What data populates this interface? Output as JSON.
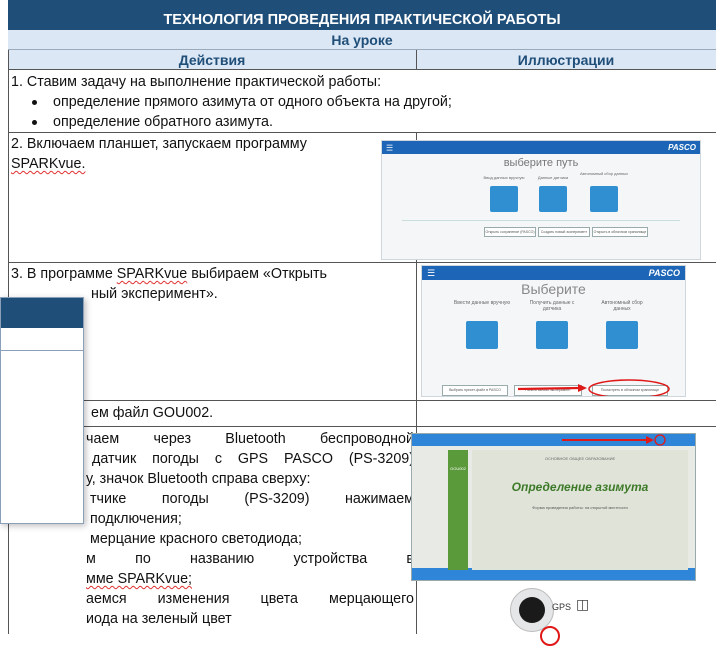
{
  "table": {
    "title": "ТЕХНОЛОГИЯ ПРОВЕДЕНИЯ ПРАКТИЧЕСКОЙ РАБОТЫ",
    "subtitle": "На уроке",
    "col_actions": "Действия",
    "col_illustrations": "Иллюстрации",
    "step1": {
      "text": "1. Ставим задачу на выполнение практической работы:",
      "bullets": [
        "определение прямого азимута от одного объекта на другой;",
        "определение обратного азимута."
      ]
    },
    "step2": {
      "line1": "2. Включаем планшет, запускаем программу",
      "line2": "SPARKvue."
    },
    "step3": {
      "line1_a": "3. В программе ",
      "line1_word": "SPARKvue",
      "line1_b": " выбираем «Открыть",
      "line2": "ный эксперимент»."
    },
    "step4": {
      "text": "ем файл GOU002."
    },
    "step5": {
      "lines": [
        "чаем через Bluetooth беспроводной",
        "датчик погоды с GPS PASCO (PS-3209)",
        "у, значок Bluetooth справа сверху:",
        "тчике погоды (PS-3209) нажимаем",
        "подключения;",
        "мерцание красного светодиода;",
        "м по названию устройства в",
        "мме SPARKvue;",
        "аемся изменения цвета мерцающего",
        "иода на зеленый цвет"
      ]
    }
  },
  "shot1": {
    "brand": "PASCO",
    "heading": "выберите путь",
    "option1": "Ввод данных вручную",
    "option2": "Данные датчика",
    "option3": "Автономный сбор данных",
    "button1": "Открыть сохранение (PASCO)",
    "button2": "Создать новый эксперимент",
    "button3": "Открыть в облачном хранилище"
  },
  "shot2": {
    "brand": "PASCO",
    "heading": "Выберите",
    "option1": "Ввести данные вручную",
    "option2": "Получить данные с датчика",
    "option3": "Автономный сбор данных",
    "button1": "Выбрать пресет-файл в PASCO",
    "button2": "Начать заново эксперимент",
    "button3": "Посмотреть в облачном хранилище"
  },
  "shot3": {
    "side_label": "GOU002",
    "header_text": "ОСНОВНОЕ ОБЩЕЕ ОБРАЗОВАНИЕ",
    "main_title": "Определение азимута",
    "subtitle": "Форма проведения работы: на открытой местности",
    "device_label": "GPS"
  },
  "colors": {
    "title_bg": "#1f4e79",
    "header_bg": "#dbe7f5",
    "app_blue": "#1d66b7",
    "green": "#5a9a3a",
    "red_marker": "#e01818"
  }
}
